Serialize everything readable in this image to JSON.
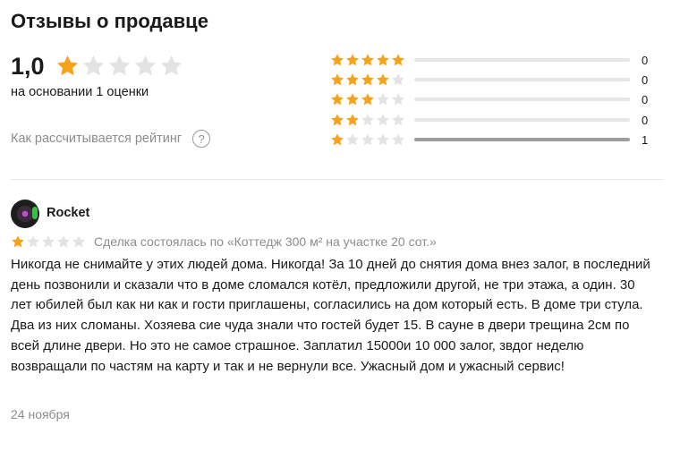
{
  "header": {
    "title": "Отзывы о продавце"
  },
  "summary": {
    "rating": "1,0",
    "rating_value": 1,
    "max_stars": 5,
    "basis": "на основании 1 оценки",
    "how_calculated": "Как рассчитывается рейтинг",
    "help_symbol": "?"
  },
  "distribution": [
    {
      "stars": 5,
      "count": "0",
      "share": 0
    },
    {
      "stars": 4,
      "count": "0",
      "share": 0
    },
    {
      "stars": 3,
      "count": "0",
      "share": 0
    },
    {
      "stars": 2,
      "count": "0",
      "share": 0
    },
    {
      "stars": 1,
      "count": "1",
      "share": 1
    }
  ],
  "review": {
    "author": "Rocket",
    "stars": 1,
    "deal": "Сделка состоялась по «Коттедж 300 м² на участке 20 сот.»",
    "text": "Никогда не снимайте у этих людей дома. Никогда! За 10 дней до снятия дома внез залог, в последний день позвонили и сказали что в доме сломался котёл, предложили другой, не три этажа, а один. 30 лет юбилей был как ни как и гости приглашены, согласились на дом который есть. В доме три стула. Два из них сломаны. Хозяева сие чуда знали что гостей будет 15. В сауне в двери трещина 2см по всей длине двери. Но это не самое страшное. Заплатил 15000и 10 000 залог, звдог неделю возвращали по частям на карту и так и не вернули все. Ужасный дом и ужасный сервис!",
    "date": "24 ноября"
  },
  "colors": {
    "star_filled": "#f7a21b",
    "star_empty": "#e3e3e3",
    "muted_text": "#8c8c8c",
    "bar_fill": "#9e9e9e",
    "bar_track": "#e6e6e6"
  },
  "icons": {
    "star": "star-icon",
    "help": "question-circle-icon",
    "avatar": "user-avatar"
  }
}
